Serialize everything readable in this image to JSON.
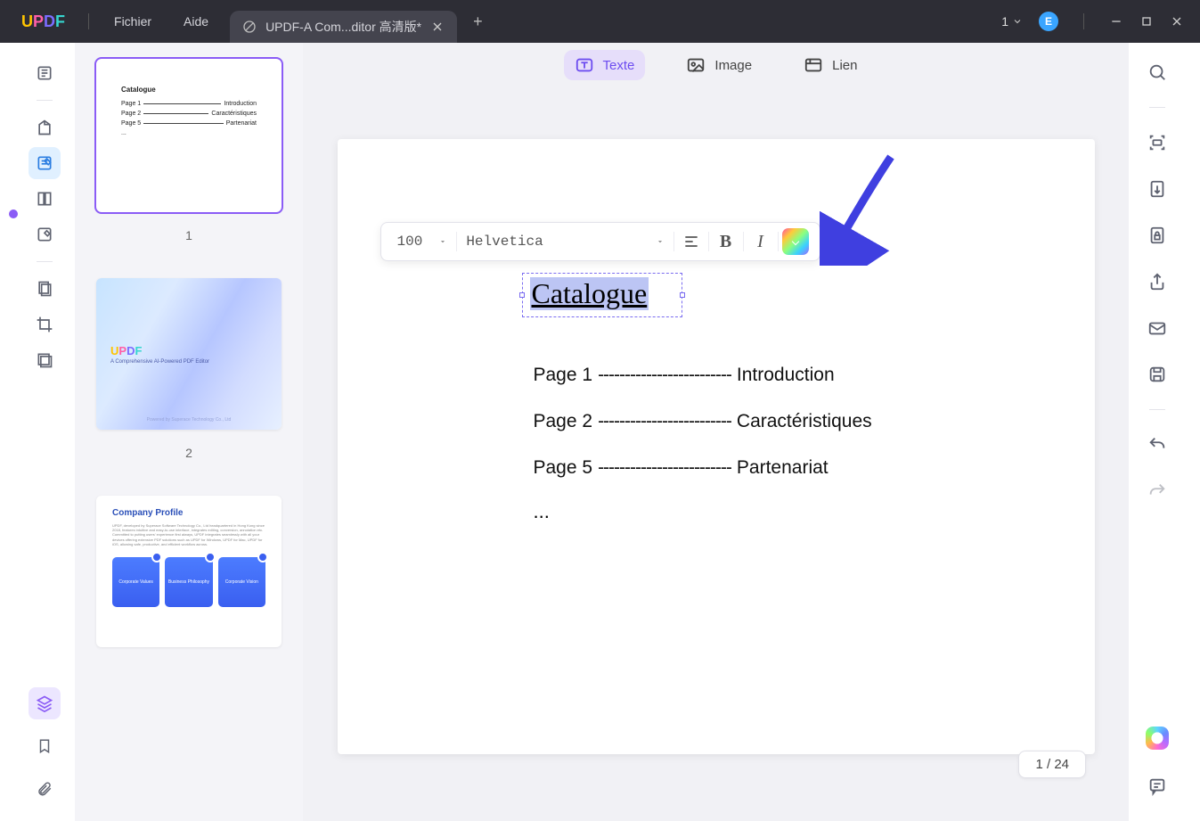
{
  "titlebar": {
    "menu_file": "Fichier",
    "menu_help": "Aide",
    "tab_title": "UPDF-A Com...ditor 高清版*",
    "counter": "1",
    "avatar_letter": "E"
  },
  "edit_toolbar": {
    "text": "Texte",
    "image": "Image",
    "link": "Lien"
  },
  "float_toolbar": {
    "font_size": "100",
    "font_family": "Helvetica",
    "bold": "B",
    "italic": "I"
  },
  "document": {
    "title": "Catalogue",
    "lines": [
      {
        "lead": "Page 1",
        "dash": "-------------------------",
        "label": "Introduction"
      },
      {
        "lead": "Page 2",
        "dash": "-------------------------",
        "label": "Caractéristiques"
      },
      {
        "lead": "Page 5",
        "dash": "-------------------------",
        "label": "Partenariat"
      }
    ],
    "ellipsis": "..."
  },
  "page_counter": "1 / 24",
  "thumbs": {
    "labels": [
      "1",
      "2"
    ],
    "thumb1": {
      "title": "Catalogue",
      "rows": [
        {
          "l": "Page 1",
          "r": "Introduction"
        },
        {
          "l": "Page 2",
          "r": "Caractéristiques"
        },
        {
          "l": "Page 5",
          "r": "Partenariat"
        }
      ],
      "dots": "..."
    },
    "thumb2": {
      "subtitle": "A Comprehensive AI-Powered PDF Editor",
      "footer": "Powered by Superace Technology Co., Ltd"
    },
    "thumb3": {
      "heading": "Company Profile",
      "cards": [
        "Corporate Values",
        "Business Philosophy",
        "Corporate Vision"
      ]
    }
  }
}
